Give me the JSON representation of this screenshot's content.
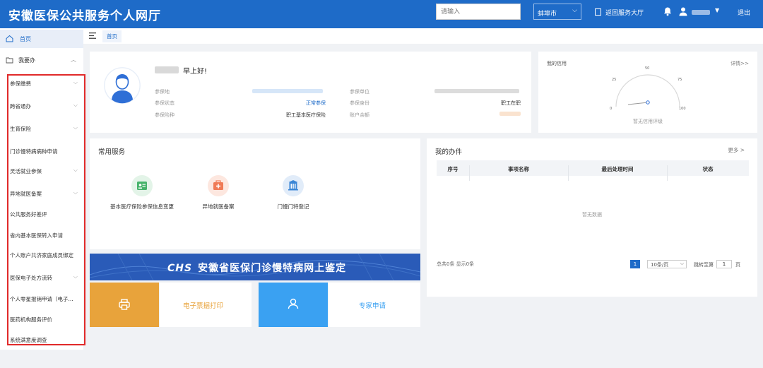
{
  "header": {
    "title": "安徽医保公共服务个人网厅",
    "search_placeholder": "请输入",
    "city": "蚌埠市",
    "return_label": "返回服务大厅",
    "logout_label": "退出"
  },
  "sidebar": {
    "home_label": "首页",
    "section_label": "我要办",
    "items": [
      {
        "label": "参保缴费",
        "expandable": true
      },
      {
        "label": "跨省通办",
        "expandable": true
      },
      {
        "label": "生育保险",
        "expandable": true
      },
      {
        "label": "门诊慢特病病种申请",
        "expandable": false
      },
      {
        "label": "灵活就业参保",
        "expandable": true
      },
      {
        "label": "异地就医备案",
        "expandable": true
      },
      {
        "label": "公共服务好差评",
        "expandable": false
      },
      {
        "label": "省内基本医保转入申请",
        "expandable": false
      },
      {
        "label": "个人账户共济家庭成员绑定",
        "expandable": false
      },
      {
        "label": "医保电子处方流转",
        "expandable": true
      },
      {
        "label": "个人零星报销申请（电子...",
        "expandable": false
      },
      {
        "label": "医药机构服务评价",
        "expandable": false
      },
      {
        "label": "系统满意度调查",
        "expandable": false
      }
    ]
  },
  "tabs": {
    "active": "首页"
  },
  "profile": {
    "greeting": "早上好!",
    "fields_left": [
      {
        "label": "参保地",
        "value": ""
      },
      {
        "label": "参保状态",
        "value": "正常参保"
      },
      {
        "label": "参保险种",
        "value": "职工基本医疗保险"
      }
    ],
    "fields_right": [
      {
        "label": "参保单位",
        "value": ""
      },
      {
        "label": "参保身份",
        "value": "职工在职"
      },
      {
        "label": "账户余额",
        "value": ""
      }
    ]
  },
  "credit": {
    "title": "我的信用",
    "detail_link": "详情>>",
    "gauge_ticks": [
      "0",
      "25",
      "50",
      "75",
      "100"
    ],
    "note": "暂无信用评级"
  },
  "services": {
    "title": "常用服务",
    "items": [
      {
        "label": "基本医疗保险参保信息变更",
        "icon": "id-card-icon",
        "color": "#46b36b",
        "bg": "#e3f4e8"
      },
      {
        "label": "异地就医备案",
        "icon": "medical-kit-icon",
        "color": "#f07a55",
        "bg": "#fde7df"
      },
      {
        "label": "门慢门特登记",
        "icon": "building-icon",
        "color": "#3a86d6",
        "bg": "#e1ecf9"
      }
    ]
  },
  "banner": {
    "text": "安徽省医保门诊慢特病网上鉴定",
    "logo": "CHS"
  },
  "tiles": [
    {
      "label": "电子票据打印",
      "icon": "printer-icon",
      "color": "#e8a33b"
    },
    {
      "label": "专家申请",
      "icon": "user-icon",
      "color": "#3aa1f2"
    }
  ],
  "work": {
    "title": "我的办件",
    "more": "更多 >",
    "columns": [
      "序号",
      "事项名称",
      "最后处理时间",
      "状态"
    ],
    "empty_text": "暂无数据",
    "pager_info": "总共0条 显示0条",
    "current_page": "1",
    "page_size": "10条/页",
    "goto_label": "跳转至第",
    "goto_value": "1",
    "goto_unit": "页"
  }
}
